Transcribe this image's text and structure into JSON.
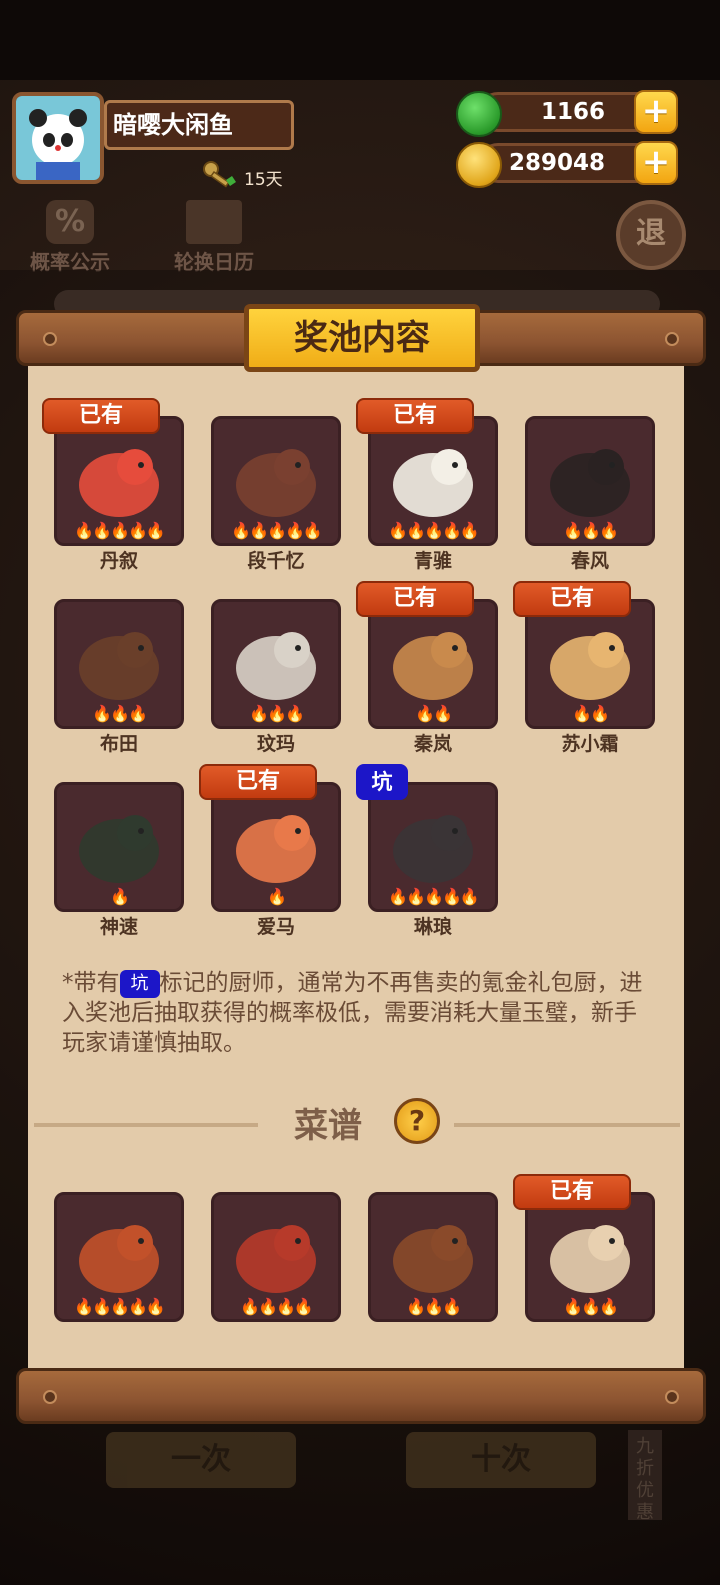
{
  "profile": {
    "name": "暗嘤大闲鱼",
    "days": "15天"
  },
  "resources": {
    "jade": "1166",
    "coins": "289048",
    "plus": "+"
  },
  "background": {
    "probability_label": "概率公示",
    "rotation_label": "轮换日历",
    "exit_label": "退",
    "draw_one_label": "一次",
    "draw_ten_label": "十次",
    "discount_label": "九折优惠"
  },
  "panel": {
    "title": "奖池内容",
    "owned_badge": "已有",
    "pit_badge": "坑"
  },
  "chefs": [
    {
      "name": "丹叙",
      "stars": 5,
      "owned": true,
      "pit": false
    },
    {
      "name": "段千忆",
      "stars": 5,
      "owned": false,
      "pit": false
    },
    {
      "name": "青骓",
      "stars": 5,
      "owned": true,
      "pit": false
    },
    {
      "name": "春风",
      "stars": 3,
      "owned": false,
      "pit": false
    },
    {
      "name": "布田",
      "stars": 3,
      "owned": false,
      "pit": false
    },
    {
      "name": "玟玛",
      "stars": 3,
      "owned": false,
      "pit": false
    },
    {
      "name": "秦岚",
      "stars": 2,
      "owned": true,
      "pit": false
    },
    {
      "name": "苏小霜",
      "stars": 2,
      "owned": true,
      "pit": false
    },
    {
      "name": "神速",
      "stars": 1,
      "owned": false,
      "pit": false
    },
    {
      "name": "爱马",
      "stars": 1,
      "owned": true,
      "pit": false
    },
    {
      "name": "琳琅",
      "stars": 5,
      "owned": false,
      "pit": true
    }
  ],
  "note": {
    "prefix": "*带有",
    "pit": "坑",
    "suffix": "标记的厨师，通常为不再售卖的氪金礼包厨，进入奖池后抽取获得的概率极低，需要消耗大量玉璧，新手玩家请谨慎抽取。"
  },
  "recipes_section": {
    "title": "菜谱",
    "help": "?"
  },
  "recipes": [
    {
      "stars": 5,
      "owned": false
    },
    {
      "stars": 4,
      "owned": false
    },
    {
      "stars": 3,
      "owned": false
    },
    {
      "stars": 3,
      "owned": true
    }
  ],
  "colors": {
    "owned_badge": "#d4481b",
    "pit_badge": "#1c16c8",
    "paper": "#e3cbaa",
    "card": "#4a2a2e"
  }
}
